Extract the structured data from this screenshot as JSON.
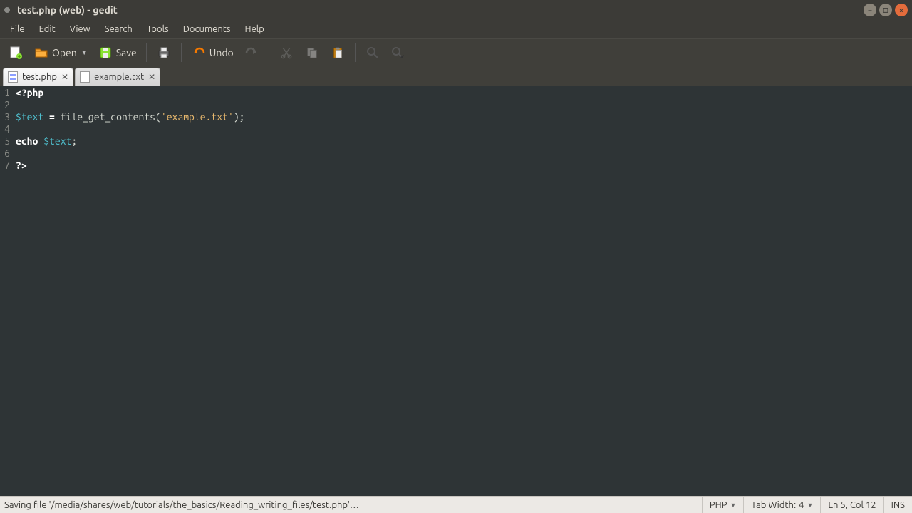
{
  "window": {
    "title": "test.php (web) - gedit"
  },
  "menu": {
    "file": "File",
    "edit": "Edit",
    "view": "View",
    "search": "Search",
    "tools": "Tools",
    "documents": "Documents",
    "help": "Help"
  },
  "toolbar": {
    "open": "Open",
    "save": "Save",
    "undo": "Undo"
  },
  "tabs": {
    "t0": {
      "label": "test.php"
    },
    "t1": {
      "label": "example.txt"
    }
  },
  "code": {
    "line_numbers": [
      "1",
      "2",
      "3",
      "4",
      "5",
      "6",
      "7"
    ],
    "line1_tag": "<?php",
    "line3_var": "$text",
    "line3_eq": " = ",
    "line3_func": "file_get_contents",
    "line3_p1": "(",
    "line3_str": "'example.txt'",
    "line3_p2": ");",
    "line5_kw": "echo",
    "line5_sp": " ",
    "line5_var": "$text",
    "line5_end": ";",
    "line7_tag": "?>"
  },
  "status": {
    "message": "Saving file '/media/shares/web/tutorials/the_basics/Reading_writing_files/test.php'…",
    "language": "PHP",
    "tabwidth_label": "Tab Width:",
    "tabwidth_value": "4",
    "position": "Ln 5, Col 12",
    "insert_mode": "INS"
  }
}
